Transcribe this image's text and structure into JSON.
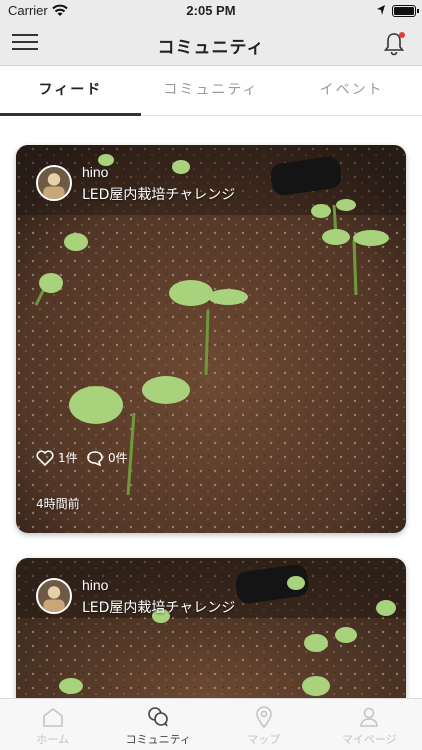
{
  "status_bar": {
    "carrier": "Carrier",
    "time": "2:05 PM"
  },
  "header": {
    "title": "コミュニティ"
  },
  "tabs": [
    {
      "label": "フィード",
      "active": true
    },
    {
      "label": "コミュニティ",
      "active": false
    },
    {
      "label": "イベント",
      "active": false
    }
  ],
  "feed": {
    "posts": [
      {
        "user": "hino",
        "group": "LED屋内栽培チャレンジ",
        "likes": "1件",
        "comments": "0件",
        "posted": "4時間前"
      },
      {
        "user": "hino",
        "group": "LED屋内栽培チャレンジ"
      }
    ]
  },
  "bottom_nav": [
    {
      "label": "ホーム",
      "icon": "home-icon",
      "active": false
    },
    {
      "label": "コミュニティ",
      "icon": "community-icon",
      "active": true
    },
    {
      "label": "マップ",
      "icon": "map-pin-icon",
      "active": false
    },
    {
      "label": "マイページ",
      "icon": "person-icon",
      "active": false
    }
  ],
  "colors": {
    "header_bg": "#ebebeb",
    "accent": "#333333",
    "notification_dot": "#e23b3b",
    "soil": "#5a3d2b",
    "sprout": "#8fc46a"
  }
}
